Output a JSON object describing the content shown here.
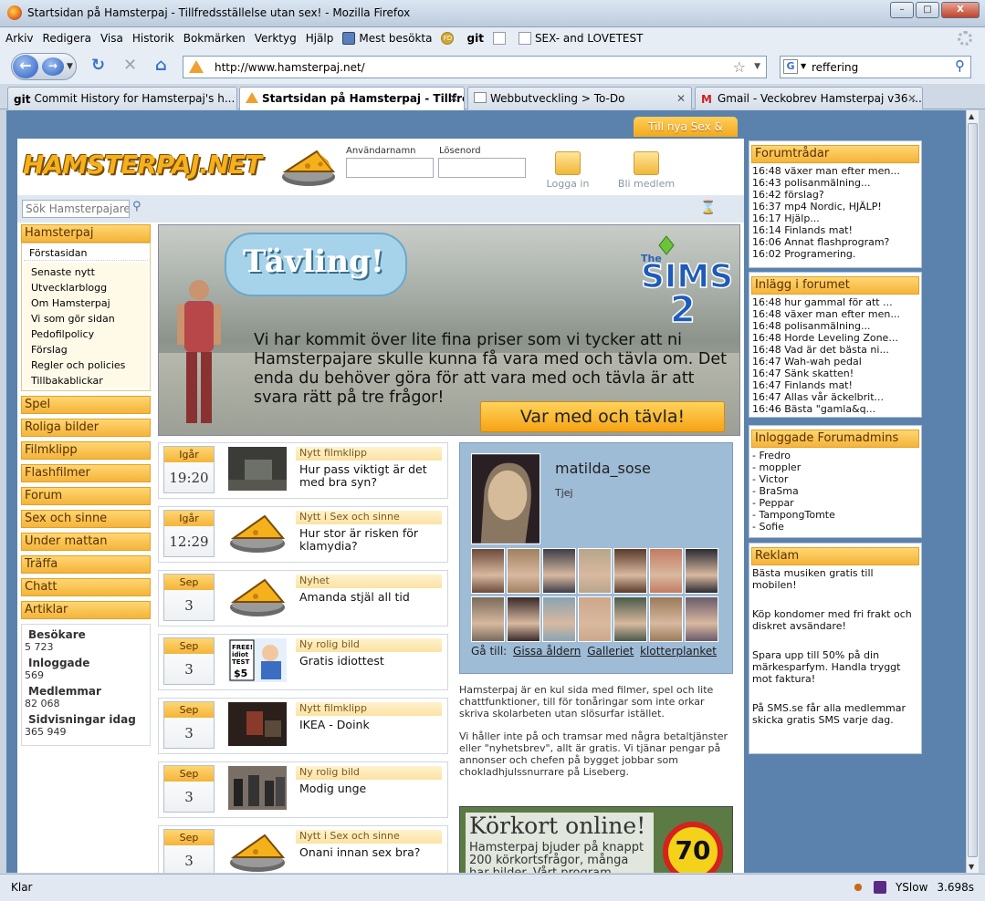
{
  "window": {
    "title": "Startsidan på Hamsterpaj - Tillfredsställelse utan sex! - Mozilla Firefox",
    "buttons": {
      "minimize": "–",
      "maximize": "□",
      "close": "X"
    }
  },
  "menu": {
    "items": [
      "Arkiv",
      "Redigera",
      "Visa",
      "Historik",
      "Bokmärken",
      "Verktyg",
      "Hjälp"
    ],
    "bookmarks": [
      {
        "label": "Mest besökta",
        "icon": "star-icon"
      },
      {
        "label": "FD",
        "icon": "fd-icon"
      },
      {
        "label": "git",
        "icon": "git-icon"
      },
      {
        "label": "",
        "icon": "page-icon"
      },
      {
        "label": "SEX- and LOVETEST",
        "icon": "page-icon"
      }
    ]
  },
  "nav": {
    "url": "http://www.hamsterpaj.net/",
    "search_engine": "G",
    "search_query": "reffering"
  },
  "tabs": [
    {
      "label": "Commit History for Hamsterpaj's h...",
      "icon": "git",
      "active": false
    },
    {
      "label": "Startsidan på Hamsterpaj - Tillfre...",
      "icon": "hp",
      "active": true
    },
    {
      "label": "Webbutveckling > To-Do",
      "icon": "doc",
      "active": false
    },
    {
      "label": "Gmail - Veckobrev Hamsterpaj v36 ...",
      "icon": "gm",
      "active": false
    }
  ],
  "tab_icons": {
    "git": "git",
    "gm": "M"
  },
  "status": {
    "text": "Klar",
    "yslow": "YSlow",
    "time": "3.698s"
  },
  "page": {
    "promo_tab": "Till nya Sex & Sinne »",
    "logo": "HAMSTERPAJ.NET",
    "login": {
      "username_label": "Användarnamn",
      "password_label": "Lösenord",
      "login_button": "Logga in",
      "register_button": "Bli medlem"
    },
    "site_search_placeholder": "Sök Hamsterpajare",
    "leftnav": {
      "main_head": "Hamsterpaj",
      "active_item": "Förstasidan",
      "sub_items": [
        "Senaste nytt",
        "Utvecklarblogg",
        "Om Hamsterpaj",
        "Vi som gör sidan",
        "Pedofilpolicy",
        "Förslag",
        "Regler och policies",
        "Tillbakablickar"
      ],
      "sections": [
        "Spel",
        "Roliga bilder",
        "Filmklipp",
        "Flashfilmer",
        "Forum",
        "Sex och sinne",
        "Under mattan",
        "Träffa",
        "Chatt",
        "Artiklar"
      ]
    },
    "stats": [
      {
        "label": "Besökare",
        "value": "5 723"
      },
      {
        "label": "Inloggade",
        "value": "569"
      },
      {
        "label": "Medlemmar",
        "value": "82 068"
      },
      {
        "label": "Sidvisningar idag",
        "value": "365 949"
      }
    ],
    "banner": {
      "bubble": "Tävling!",
      "sims_the": "The",
      "sims_name": "SIMS",
      "sims_num": "2",
      "text": "Vi har kommit över lite fina priser som vi tycker att ni Hamsterpajare skulle kunna få vara med och tävla om. Det enda du behöver göra för att vara med och tävla är att svara rätt på tre frågor!",
      "cta": "Var med och tävla!"
    },
    "news": [
      {
        "day": "Igår",
        "time": "19:20",
        "category": "Nytt filmklipp",
        "title": "Hur pass viktigt är det med bra syn?",
        "thumb": "video"
      },
      {
        "day": "Igår",
        "time": "12:29",
        "category": "Nytt i Sex och sinne",
        "title": "Hur stor är risken för klamydia?",
        "thumb": "cheese"
      },
      {
        "day": "Sep",
        "time": "3",
        "category": "Nyhet",
        "title": "Amanda stjäl all tid",
        "thumb": "cheese"
      },
      {
        "day": "Sep",
        "time": "3",
        "category": "Ny rolig bild",
        "title": "Gratis idiottest",
        "thumb": "comic"
      },
      {
        "day": "Sep",
        "time": "3",
        "category": "Nytt filmklipp",
        "title": "IKEA - Doink",
        "thumb": "video2"
      },
      {
        "day": "Sep",
        "time": "3",
        "category": "Ny rolig bild",
        "title": "Modig unge",
        "thumb": "crowd"
      },
      {
        "day": "Sep",
        "time": "3",
        "category": "Nytt i Sex och sinne",
        "title": "Onani innan sex bra?",
        "thumb": "cheese"
      }
    ],
    "comic_text": [
      "FREE!",
      "idiot",
      "TEST",
      "$5"
    ],
    "profile": {
      "username": "matilda_sose",
      "gender": "Tjej",
      "goto_label": "Gå till:",
      "links": [
        "Gissa åldern",
        "Galleriet",
        "klotterplanket"
      ],
      "thumb_colors": [
        "#6b4a3a",
        "#a08060",
        "#3d3d4a",
        "#b7a58a",
        "#5a3a2a",
        "#c47a62",
        "#2b2b33",
        "#7a6a5a",
        "#3a2a2a",
        "#8aa3b3",
        "#cda78a",
        "#4a5a4a",
        "#9a7a5a",
        "#6a5a6a"
      ]
    },
    "about": [
      "Hamsterpaj är en kul sida med filmer, spel och lite chattfunktioner, till för tonåringar som inte orkar skriva skolarbeten utan slösurfar istället.",
      "Vi håller inte på och tramsar med några betaltjänster eller \"nyhetsbrev\", allt är gratis. Vi tjänar pengar på annonser och chefen på bygget jobbar som chokladhjulssnurrare på Liseberg."
    ],
    "korkort": {
      "title": "Körkort online!",
      "text": "Hamsterpaj bjuder på knappt 200 körkortsfrågor, många har bilder. Vårt program håller",
      "sign": "70"
    },
    "forum_threads": {
      "title": "Forumtrådar",
      "items": [
        "16:48 växer man efter men...",
        "16:43 polisanmälning...",
        "16:42 förslag?",
        "16:37 mp4 Nordic, HJÄLP!",
        "16:17 Hjälp...",
        "16:14 Finlands mat!",
        "16:06 Annat flashprogram?",
        "16:02 Programering."
      ]
    },
    "forum_posts": {
      "title": "Inlägg i forumet",
      "items": [
        "16:48 hur gammal för att ...",
        "16:48 växer man efter men...",
        "16:48 polisanmälning...",
        "16:48 Horde Leveling Zone...",
        "16:48 Vad är det bästa ni...",
        "16:47 Wah-wah pedal",
        "16:47 Sänk skatten!",
        "16:47 Finlands mat!",
        "16:47 Allas vår äckelbrit...",
        "16:46 Bästa \"gamla&q..."
      ]
    },
    "admins": {
      "title": "Inloggade Forumadmins",
      "items": [
        "- Fredro",
        "- moppler",
        "- Victor",
        "- BraSma",
        "- Peppar",
        "- TampongTomte",
        "- Sofie"
      ]
    },
    "ads": {
      "title": "Reklam",
      "items": [
        "Bästa musiken gratis till mobilen!",
        "Köp kondomer med fri frakt och diskret avsändare!",
        "Spara upp till 50% på din märkesparfym. Handla tryggt mot faktura!",
        "På SMS.se får alla medlemmar skicka gratis SMS varje dag."
      ]
    }
  }
}
